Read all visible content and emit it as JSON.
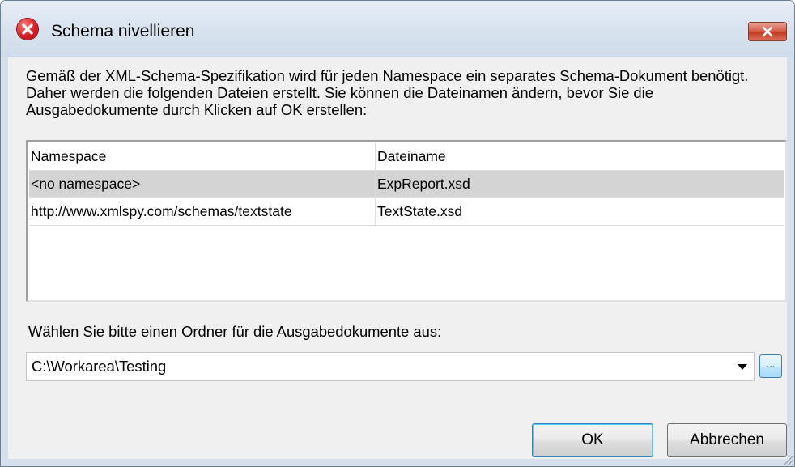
{
  "window": {
    "title": "Schema nivellieren",
    "app_icon": "altova-xmlspy-icon",
    "close_icon": "close-icon"
  },
  "dialog": {
    "intro_text": "Gemäß der XML-Schema-Spezifikation wird für jeden Namespace ein separates Schema-Dokument benötigt. Daher werden die folgenden Dateien erstellt. Sie können die Dateinamen ändern, bevor Sie die Ausgabedokumente durch Klicken auf OK erstellen:",
    "table": {
      "headers": [
        "Namespace",
        "Dateiname"
      ],
      "rows": [
        {
          "namespace": "<no namespace>",
          "filename": "ExpReport.xsd",
          "selected": true
        },
        {
          "namespace": "http://www.xmlspy.com/schemas/textstate",
          "filename": "TextState.xsd",
          "selected": false
        }
      ]
    },
    "folder_label": "Wählen Sie bitte einen Ordner für die Ausgabedokumente aus:",
    "folder_value": "C:\\Workarea\\Testing",
    "browse_label": "...",
    "ok_label": "OK",
    "cancel_label": "Abbrechen"
  },
  "colors": {
    "selection": "#d4d4d4",
    "title_bar": "#dae4f0",
    "close_button": "#c23b24",
    "accent_border": "#3c7fb1"
  }
}
